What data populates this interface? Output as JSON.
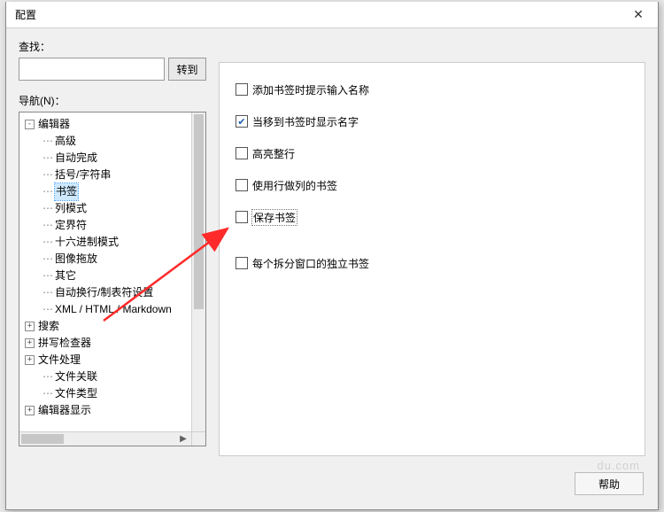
{
  "dialog": {
    "title": "配置",
    "close_icon": "✕"
  },
  "find": {
    "label": "查找：",
    "go_label": "转到",
    "value": ""
  },
  "nav": {
    "label": "导航(N)：",
    "tree": [
      {
        "depth": 0,
        "expander": "-",
        "label": "编辑器"
      },
      {
        "depth": 1,
        "expander": "",
        "label": "高级"
      },
      {
        "depth": 1,
        "expander": "",
        "label": "自动完成"
      },
      {
        "depth": 1,
        "expander": "",
        "label": "括号/字符串"
      },
      {
        "depth": 1,
        "expander": "",
        "label": "书签",
        "selected": true
      },
      {
        "depth": 1,
        "expander": "",
        "label": "列模式"
      },
      {
        "depth": 1,
        "expander": "",
        "label": "定界符"
      },
      {
        "depth": 1,
        "expander": "",
        "label": "十六进制模式"
      },
      {
        "depth": 1,
        "expander": "",
        "label": "图像拖放"
      },
      {
        "depth": 1,
        "expander": "",
        "label": "其它"
      },
      {
        "depth": 1,
        "expander": "",
        "label": "自动换行/制表符设置"
      },
      {
        "depth": 1,
        "expander": "",
        "label": "XML / HTML / Markdown"
      },
      {
        "depth": 0,
        "expander": "+",
        "label": "搜索"
      },
      {
        "depth": 0,
        "expander": "+",
        "label": "拼写检查器"
      },
      {
        "depth": 0,
        "expander": "+",
        "label": "文件处理"
      },
      {
        "depth": 1,
        "expander": "",
        "label": "文件关联"
      },
      {
        "depth": 1,
        "expander": "",
        "label": "文件类型"
      },
      {
        "depth": 0,
        "expander": "+",
        "label": "编辑器显示"
      }
    ]
  },
  "options": {
    "items": [
      {
        "label": "添加书签时提示输入名称",
        "checked": false
      },
      {
        "label": "当移到书签时显示名字",
        "checked": true
      },
      {
        "label": "高亮整行",
        "checked": false
      },
      {
        "label": "使用行做列的书签",
        "checked": false
      },
      {
        "label": "保存书签",
        "checked": false,
        "focused": true,
        "gap_after": true
      },
      {
        "label": "每个拆分窗口的独立书签",
        "checked": false
      }
    ]
  },
  "buttons": {
    "help": "帮助"
  },
  "watermark": "du.com"
}
